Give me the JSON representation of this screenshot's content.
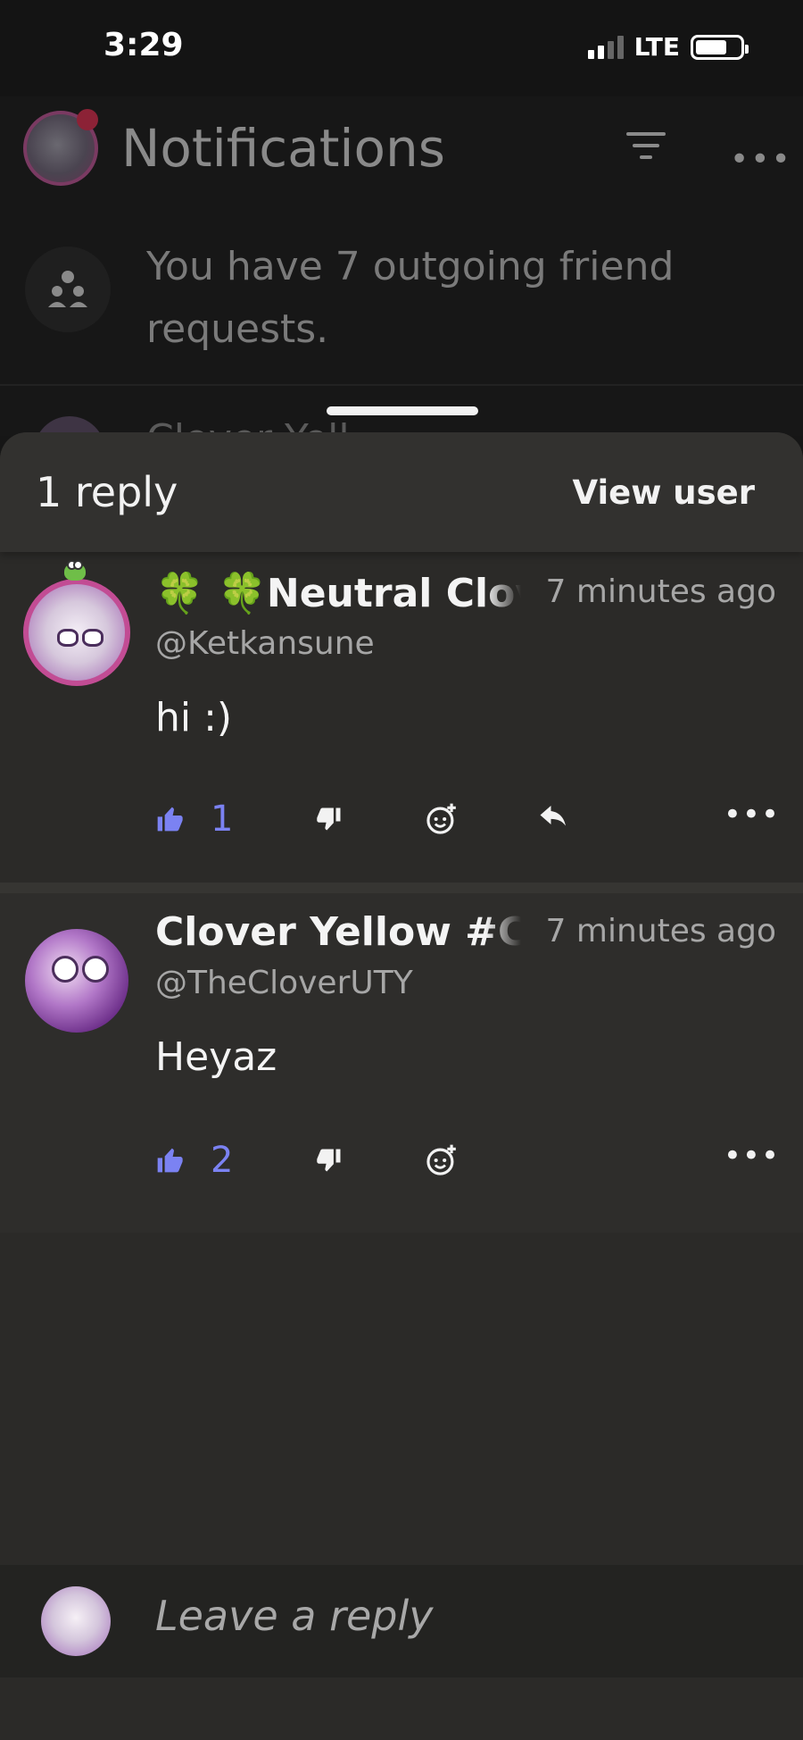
{
  "status_bar": {
    "time": "3:29",
    "network": "LTE",
    "battery_level": 0.7,
    "signal_bars": 2
  },
  "background_page": {
    "title": "Notifications",
    "friend_requests_text": "You have 7 outgoing friend requests.",
    "peek_name": "Clover Yell"
  },
  "sheet": {
    "title": "1 reply",
    "view_user_label": "View user"
  },
  "replies": [
    {
      "name": "🍀 🍀Neutral Clov",
      "handle": "@Ketkansune",
      "time": "7 minutes ago",
      "text": "hi :)",
      "likes": "1",
      "has_reply_button": true
    },
    {
      "name": "Clover Yellow #CL",
      "handle": "@TheCloverUTY",
      "time": "7 minutes ago",
      "text": "Heyaz",
      "likes": "2",
      "has_reply_button": false
    }
  ],
  "reply_bar": {
    "placeholder": "Leave a reply"
  },
  "colors": {
    "accent": "#7b82f2",
    "sheet_bg": "#2b2a28",
    "page_bg": "#171717"
  },
  "icons": [
    "thumbs-up-icon",
    "thumbs-down-icon",
    "add-reaction-icon",
    "reply-arrow-icon",
    "more-icon",
    "filter-icon",
    "friends-icon"
  ]
}
